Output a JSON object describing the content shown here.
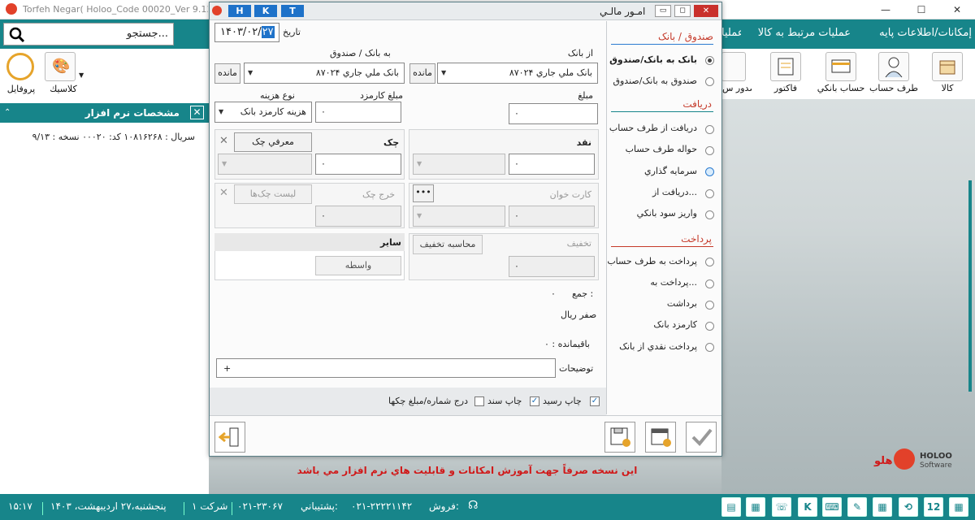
{
  "app": {
    "title": "Torfeh Negar( Holoo_Code  00020_Ver 9.13_ SR :10816",
    "minimize": "—",
    "maximize": "☐",
    "close": "✕"
  },
  "menu": {
    "items": [
      "إمكانات/اطلاعات پايه",
      "عمليات مرتبط به كالا",
      "عمليا"
    ]
  },
  "search": {
    "placeholder": "جستجو..."
  },
  "left_toolbar": {
    "profile": "پروفايل",
    "classic": "كلاسيك"
  },
  "right_toolbar": [
    "كالا",
    "طرف حساب",
    "حساب بانکي",
    "فاكتور",
    "صدور س"
  ],
  "props": {
    "title": "مشخصات نرم افزار",
    "serial_line": "سريال : ۱۰۸۱۶۲۶۸  كد: ۰۰۰۲۰  نسخه : ۹/۱۳"
  },
  "dialog": {
    "title": "امـور مالـي",
    "hkt": [
      "H",
      "K",
      "T"
    ],
    "date_label": "تاريخ",
    "date_value": "۱۴۰۳/۰۲/",
    "date_day": "۲۷",
    "from_bank_label": "از بانک",
    "from_bank_value": "بانک ملي جاري ۸۷۰۲۴",
    "to_bank_label": "به بانک / صندوق",
    "to_bank_value": "بانک ملي جاري ۸۷۰۲۴",
    "balance_btn": "مانده",
    "amount_label": "مبلغ",
    "amount_value": "۰",
    "fee_label": "مبلغ كارمزد",
    "fee_value": "۰",
    "cost_type_label": "نوع هزينه",
    "cost_type_value": "هزينه كارمزد بانک",
    "cash_label": "نقد",
    "cash_value": "۰",
    "cheque_label": "چک",
    "introduce_cheque": "معرفي چک",
    "cheque_value": "۰",
    "card_reader_label": "كارت خوان",
    "card_reader_btn": "•••",
    "card_value": "۰",
    "spend_cheque_label": "خرج چک",
    "cheque_list": "ليست چک‌ها",
    "spend_value": "۰",
    "discount_label": "تخفيف",
    "calc_discount": "محاسبه تخفيف",
    "discount_value": "۰",
    "other_label": "ساير",
    "intermediary": "واسطه",
    "sum_label": "جمع :",
    "sum_value": "۰",
    "sum_words": "صفر ريال",
    "remain_label": "باقيمانده : ۰",
    "desc_label": "توضيحات",
    "desc_plus": "+",
    "print_receipt": "چاپ رسيد",
    "print_doc": "چاپ سند",
    "insert_number": "درج شماره/مبلغ چكها",
    "sections": {
      "fund_bank": "صندوق / بانک",
      "receive": "دريافت",
      "payment": "پرداخت"
    },
    "options_fund": [
      "بانک به بانک/صندوق",
      "صندوق به بانک/صندوق"
    ],
    "options_receive": [
      "دريافت از طرف حساب",
      "حواله طرف حساب",
      "سرمايه گذاري",
      "دريافت از...",
      "واريز سود بانکي"
    ],
    "options_payment": [
      "پرداخت به طرف حساب",
      "پرداخت به...",
      "برداشت",
      "كارمزد بانک",
      "پرداخت نقدي از بانک"
    ]
  },
  "bg_text": {
    "promo": "اين نسخه صرفاً جهت آموزش امكانات و قابليت هاي نرم افزار مي باشد",
    "logo_en": "HOLOO",
    "logo_sub": "Software",
    "logo_fa": "هلو"
  },
  "status": {
    "time": "۱۵:۱۷",
    "date": "پنجشنبه،۲۷ ارديبهشت، ۱۴۰۳",
    "company": "شركت ۱",
    "support_label": "پشتيباني:",
    "support_phone": "۰۲۱-۲۳۰۶۷",
    "sales_label": "فروش:",
    "sales_phone": "۰۲۱-۲۲۲۲۱۱۴۲"
  },
  "colors": {
    "teal": "#17858a",
    "accent_red": "#c53a2a",
    "hkt_blue": "#1e72c9"
  }
}
